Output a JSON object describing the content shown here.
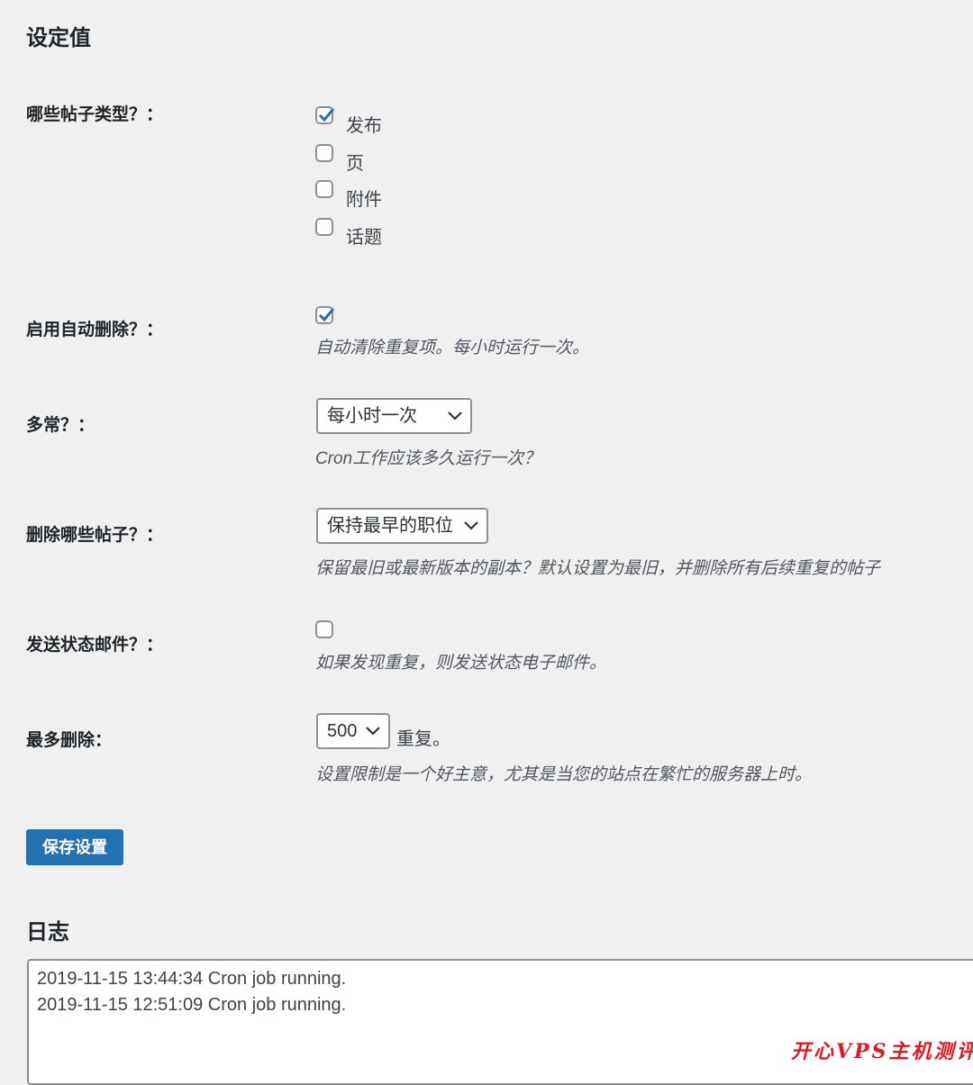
{
  "page": {
    "title": "设定值"
  },
  "post_types": {
    "label": "哪些帖子类型？：",
    "options": [
      {
        "label": "发布",
        "checked": true
      },
      {
        "label": "页",
        "checked": false
      },
      {
        "label": "附件",
        "checked": false
      },
      {
        "label": "话题",
        "checked": false
      }
    ]
  },
  "auto_delete": {
    "label": "启用自动删除？：",
    "checked": true,
    "description": "自动清除重复项。每小时运行一次。"
  },
  "frequency": {
    "label": "多常？：",
    "selected": "每小时一次",
    "description": "Cron工作应该多久运行一次？"
  },
  "which_posts": {
    "label": "删除哪些帖子？：",
    "selected": "保持最早的职位",
    "description": "保留最旧或最新版本的副本？默认设置为最旧，并删除所有后续重复的帖子"
  },
  "status_email": {
    "label": "发送状态邮件？：",
    "checked": false,
    "description": "如果发现重复，则发送状态电子邮件。"
  },
  "max_delete": {
    "label": "最多删除：",
    "selected": "500",
    "suffix": "重复。",
    "description": "设置限制是一个好主意，尤其是当您的站点在繁忙的服务器上时。"
  },
  "save_button": "保存设置",
  "log": {
    "title": "日志",
    "entries": [
      "2019-11-15 13:44:34 Cron job running.",
      "2019-11-15 12:51:09 Cron job running."
    ]
  },
  "watermark": "开心VPS主机测评",
  "colors": {
    "primary_button": "#2271b1",
    "checkmark": "#2271b1",
    "background": "#f0f0f1",
    "watermark": "#e4171f"
  }
}
